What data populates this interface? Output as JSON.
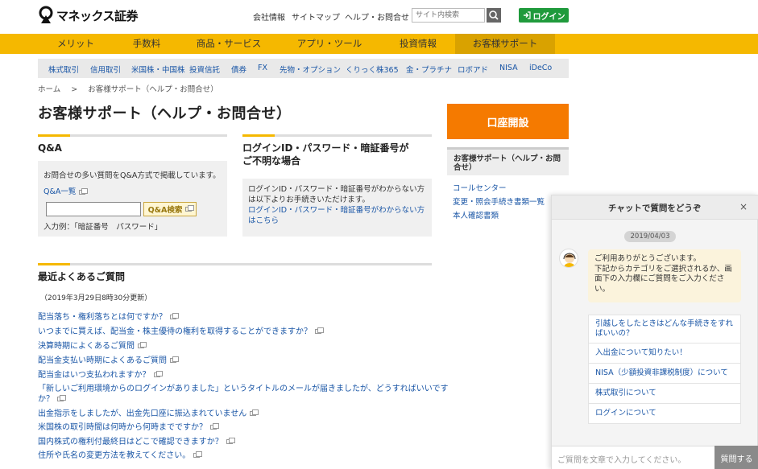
{
  "header": {
    "logo_text": "マネックス証券",
    "util_links": [
      "会社情報",
      "サイトマップ",
      "ヘルプ・お問合せ"
    ],
    "search_placeholder": "サイト内検索",
    "login_label": "ログイン"
  },
  "main_nav": [
    "メリット",
    "手数料",
    "商品・サービス",
    "アプリ・ツール",
    "投資情報",
    "お客様サポート"
  ],
  "sub_nav": [
    "株式取引",
    "信用取引",
    "米国株・中国株",
    "投資信託",
    "債券",
    "FX",
    "先物・オプション",
    "くりっく株365",
    "金・プラチナ",
    "ロボアド",
    "NISA",
    "iDeCo"
  ],
  "breadcrumb": {
    "home": "ホーム",
    "sep": ">",
    "current": "お客様サポート（ヘルプ・お問合せ）"
  },
  "page_title": "お客様サポート（ヘルプ・お問合せ）",
  "qa": {
    "title": "Q&A",
    "desc": "お問合せの多い質問をQ&A方式で掲載しています。",
    "list_link": "Q&A一覧",
    "search_button": "Q&A検索",
    "example": "入力例：「暗証番号　パスワード」"
  },
  "login_help": {
    "title_line1": "ログインID・パスワード・暗証番号が",
    "title_line2": "ご不明な場合",
    "text_line1": "ログインID・パスワード・暗証番号がわからない方",
    "text_line2": "は以下よりお手続きいただけます。",
    "link_line1": "ログインID・パスワード・暗証番号がわからない方",
    "link_line2": "はこちら"
  },
  "faq": {
    "title": "最近よくあるご質問",
    "updated": "（2019年3月29日8時30分更新）",
    "items": [
      "配当落ち・権利落ちとは何ですか？",
      "いつまでに買えば、配当金・株主優待の権利を取得することができますか？",
      "決算時期によくあるご質問",
      "配当金支払い時期によくあるご質問",
      "配当金はいつ支払われますか？",
      "「新しいご利用環境からのログインがありました」というタイトルのメールが届きましたが、どうすればいいです",
      "か？",
      "出金指示をしましたが、出金先口座に振込まれていません",
      "米国株の取引時間は何時から何時までですか？",
      "国内株式の権利付最終日はどこで確認できますか？",
      "住所や氏名の変更方法を教えてください。"
    ]
  },
  "sidebar": {
    "open_account": "口座開設",
    "box_title_line1": "お客様サポート（ヘルプ・お問",
    "box_title_line2": "合せ）",
    "links": [
      "コールセンター",
      "変更・照会手続き書類一覧",
      "本人確認書類"
    ]
  },
  "chat": {
    "title": "チャットで質問をどうぞ",
    "close": "×",
    "date": "2019/04/03",
    "greeting_lines": [
      "ご利用ありがとうございます。",
      "下記からカテゴリをご選択されるか、画",
      "面下の入力欄にご質問をご入力くださ",
      "い。"
    ],
    "options": [
      [
        "引越しをしたときはどんな手続きをすれ",
        "ばいいの？"
      ],
      [
        "入出金について知りたい！"
      ],
      [
        "NISA（少額投資非課税制度）について"
      ],
      [
        "株式取引について"
      ],
      [
        "ログインについて"
      ]
    ],
    "input_placeholder": "ご質問を文章で入力してください。",
    "send_label": "質問する"
  },
  "colors": {
    "brand_yellow": "#f5b800",
    "open_orange": "#f57a00",
    "login_green": "#1f9a3c",
    "link_blue": "#1a56a6"
  }
}
